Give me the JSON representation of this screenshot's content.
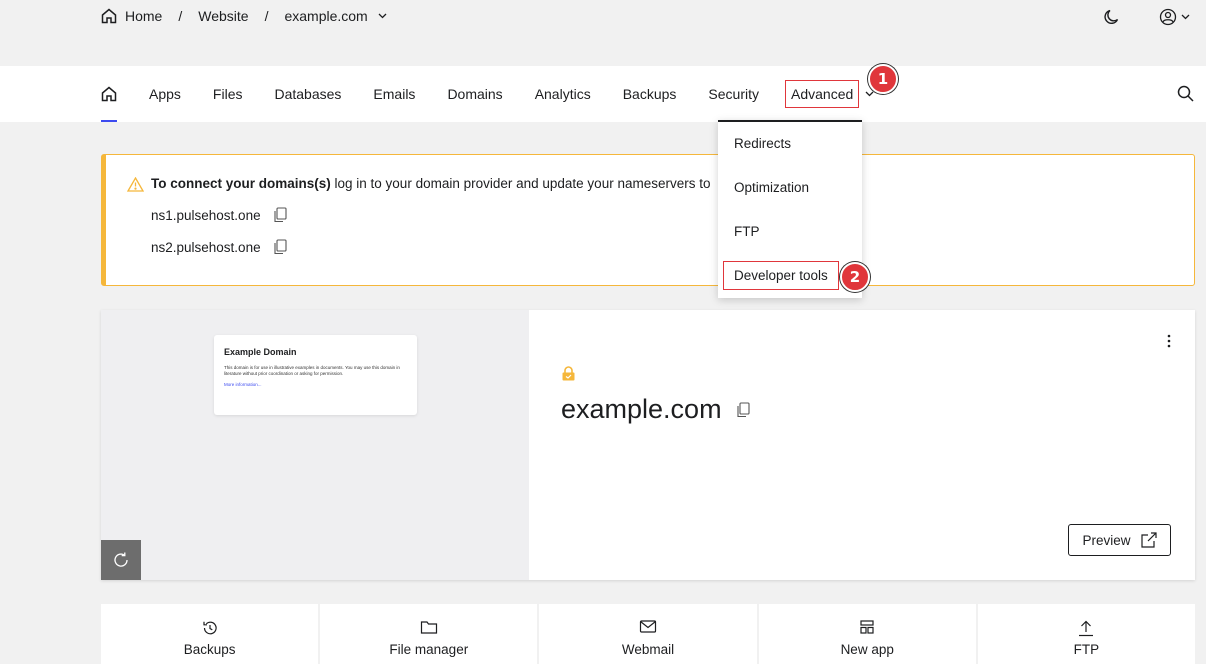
{
  "breadcrumb": {
    "home": "Home",
    "separator": "/",
    "website": "Website",
    "domain": "example.com"
  },
  "nav": {
    "items": [
      "Apps",
      "Files",
      "Databases",
      "Emails",
      "Domains",
      "Analytics",
      "Backups",
      "Security"
    ],
    "advanced": "Advanced",
    "active": "home-icon"
  },
  "dropdown": {
    "items": [
      "Redirects",
      "Optimization",
      "FTP",
      "Developer tools"
    ]
  },
  "annotations": {
    "step1": "1",
    "step2": "2"
  },
  "alert": {
    "bold": "To connect your domains(s)",
    "rest": " log in to your domain provider and update your nameservers to",
    "ns1": "ns1.pulsehost.one",
    "ns2": "ns2.pulsehost.one"
  },
  "site": {
    "thumb_title": "Example Domain",
    "thumb_body": "This domain is for use in illustrative examples in documents. You may use this domain in literature without prior coordination or asking for permission.",
    "thumb_link": "More information...",
    "domain": "example.com",
    "preview_label": "Preview"
  },
  "quick_actions": [
    "Backups",
    "File manager",
    "Webmail",
    "New app",
    "FTP"
  ],
  "colors": {
    "accent": "#3d4bf0",
    "warning": "#f5b73b",
    "annotation": "#e0363b",
    "lock": "#f5b73b"
  }
}
